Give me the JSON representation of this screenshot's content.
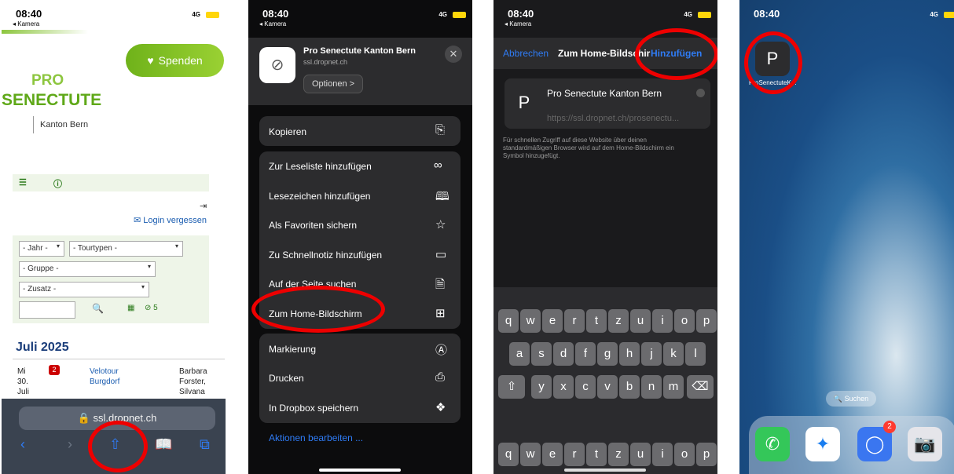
{
  "status": {
    "time": "08:40",
    "back": "◂ Kamera",
    "network": "4G"
  },
  "p1": {
    "donate": "Spenden",
    "logo_line1": "PRO",
    "logo_line2": "SENECTUTE",
    "org": "Kanton Bern",
    "login_forgot": "Login vergessen",
    "filters": {
      "year": "- Jahr -",
      "tour_types": "- Tourtypen -",
      "group": "- Gruppe -",
      "extra": "- Zusatz -"
    },
    "count": "5",
    "month": "Juli 2025",
    "event": {
      "day": "Mi",
      "date": "30.",
      "month": "Juli",
      "badge": "2",
      "title1": "Velotour",
      "title2": "Burgdorf",
      "person1": "Barbara",
      "person2": "Forster,",
      "person3": "Silvana"
    },
    "url": "ssl.dropnet.ch"
  },
  "p2": {
    "site_title": "Pro Senectute Kanton Bern",
    "site_url": "ssl.dropnet.ch",
    "options": "Optionen >",
    "copy": "Kopieren",
    "menu": [
      "Zur Leseliste hinzufügen",
      "Lesezeichen hinzufügen",
      "Als Favoriten sichern",
      "Zu Schnellnotiz hinzufügen",
      "Auf der Seite suchen",
      "Zum Home-Bildschirm"
    ],
    "menu2": [
      "Markierung",
      "Drucken",
      "In Dropbox speichern"
    ],
    "edit_actions": "Aktionen bearbeiten ..."
  },
  "p3": {
    "cancel": "Abbrechen",
    "title": "Zum Home-Bildschirm",
    "add": "Hinzufügen",
    "icon_letter": "P",
    "name": "Pro Senectute Kanton Bern",
    "url": "https://ssl.dropnet.ch/prosenectu...",
    "note": "Für schnellen Zugriff auf diese Website über deinen standardmäßigen Browser wird auf dem Home-Bildschirm ein Symbol hinzugefügt.",
    "keys_row1": [
      "q",
      "w",
      "e",
      "r",
      "t",
      "z",
      "u",
      "i",
      "o",
      "p"
    ],
    "keys_row2": [
      "a",
      "s",
      "d",
      "f",
      "g",
      "h",
      "j",
      "k",
      "l"
    ],
    "keys_row3": [
      "y",
      "x",
      "c",
      "v",
      "b",
      "n",
      "m"
    ]
  },
  "p4": {
    "icon_letter": "P",
    "icon_label": "ProSenectuteK...",
    "search": "Suchen",
    "signal_badge": "2"
  }
}
